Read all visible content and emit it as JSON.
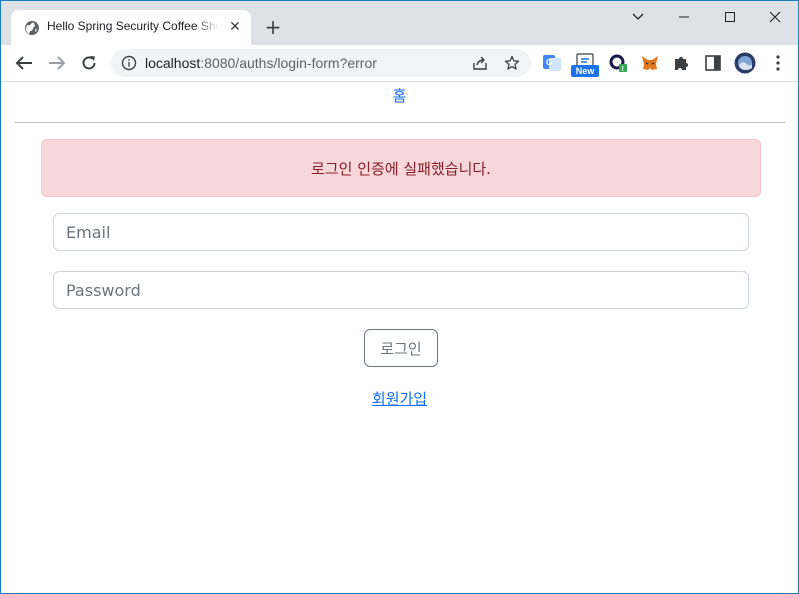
{
  "browser": {
    "tab": {
      "title": "Hello Spring Security Coffee Shop",
      "favicon": "globe-icon",
      "close": "✕"
    },
    "new_tab": "+",
    "window_controls": [
      "chevron-down-icon",
      "minimize-icon",
      "maximize-icon",
      "close-icon"
    ],
    "address": {
      "host": "localhost",
      "rest": ":8080/auths/login-form?error"
    },
    "extensions": [
      "google-translate-icon",
      "new-badge-extension-icon",
      "o-extension-icon",
      "metamask-fox-icon",
      "puzzle-extensions-icon",
      "side-panel-icon",
      "profile-avatar-icon",
      "more-vert-icon"
    ],
    "new_badge": "New"
  },
  "page": {
    "home_link": "홈",
    "alert": "로그인 인증에 실패했습니다.",
    "email": {
      "placeholder": "Email",
      "value": ""
    },
    "password": {
      "placeholder": "Password",
      "value": ""
    },
    "login_button": "로그인",
    "signup_link": "회원가입"
  },
  "colors": {
    "accent": "#0d6efd",
    "alert_bg": "#f8d7da",
    "alert_text": "#842029",
    "window_border": "#1b7ec4"
  }
}
